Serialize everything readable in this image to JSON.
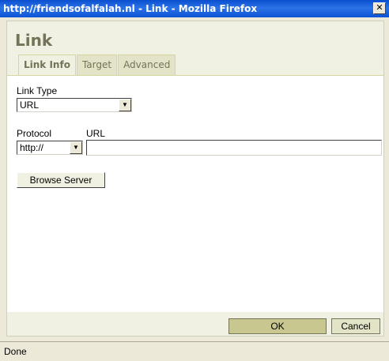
{
  "window": {
    "title": "http://friendsofalfalah.nl - Link - Mozilla Firefox",
    "close_glyph": "✕"
  },
  "dialog": {
    "title": "Link",
    "tabs": [
      {
        "label": "Link Info",
        "active": true
      },
      {
        "label": "Target",
        "active": false
      },
      {
        "label": "Advanced",
        "active": false
      }
    ],
    "link_type": {
      "label": "Link Type",
      "value": "URL"
    },
    "protocol": {
      "label": "Protocol",
      "value": "http://"
    },
    "url": {
      "label": "URL",
      "value": ""
    },
    "browse_server_label": "Browse Server",
    "ok_label": "OK",
    "cancel_label": "Cancel"
  },
  "statusbar": {
    "text": "Done"
  },
  "colors": {
    "titlebar": "#0a4fcf",
    "dialog_bg": "#f1f1e3",
    "ok_bg": "#c7c78f"
  }
}
